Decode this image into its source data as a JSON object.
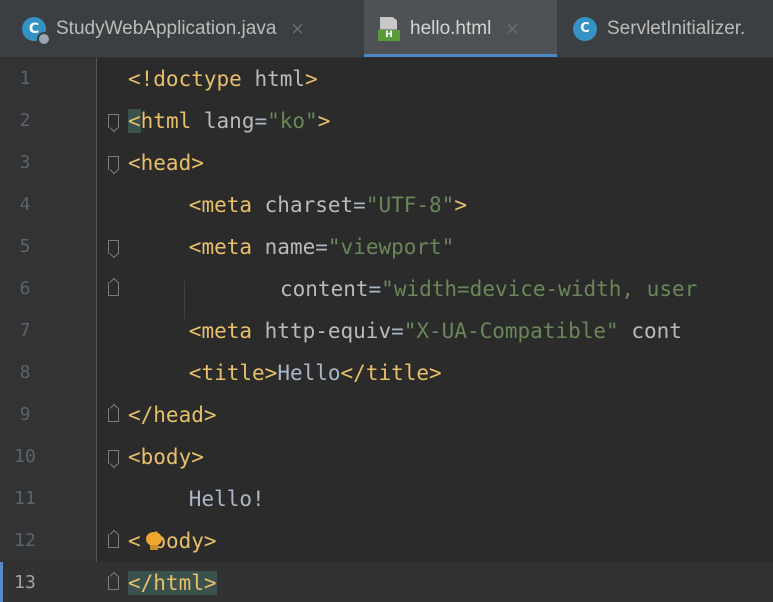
{
  "tabs": [
    {
      "label": "StudyWebApplication.java",
      "icon": "java-class-icon",
      "close": "×",
      "active": false
    },
    {
      "label": "hello.html",
      "icon": "html-file-icon",
      "icon_text": "H",
      "close": "×",
      "active": true
    },
    {
      "label": "ServletInitializer.",
      "icon": "class-icon",
      "icon_text": "C",
      "active": false
    }
  ],
  "editor": {
    "current_line": 13,
    "lines": [
      {
        "number": "1",
        "indent": "",
        "parts": [
          {
            "t": "tag",
            "v": "<!doctype "
          },
          {
            "t": "attr",
            "v": "html"
          },
          {
            "t": "tag",
            "v": ">"
          }
        ]
      },
      {
        "number": "2",
        "indent": "",
        "fold": "open",
        "parts": [
          {
            "t": "tag hl",
            "v": "<"
          },
          {
            "t": "tag",
            "v": "html"
          },
          {
            "t": "txt",
            "v": " "
          },
          {
            "t": "attr",
            "v": "lang"
          },
          {
            "t": "txt",
            "v": "="
          },
          {
            "t": "str",
            "v": "\"ko\""
          },
          {
            "t": "tag",
            "v": ">"
          }
        ]
      },
      {
        "number": "3",
        "indent": "",
        "fold": "open",
        "parts": [
          {
            "t": "tag",
            "v": "<head>"
          }
        ]
      },
      {
        "number": "4",
        "indent": "    ",
        "parts": [
          {
            "t": "tag",
            "v": "<meta "
          },
          {
            "t": "attr",
            "v": "charset"
          },
          {
            "t": "txt",
            "v": "="
          },
          {
            "t": "str",
            "v": "\"UTF-8\""
          },
          {
            "t": "tag",
            "v": ">"
          }
        ]
      },
      {
        "number": "5",
        "indent": "    ",
        "fold": "open",
        "parts": [
          {
            "t": "tag",
            "v": "<meta "
          },
          {
            "t": "attr",
            "v": "name"
          },
          {
            "t": "txt",
            "v": "="
          },
          {
            "t": "str",
            "v": "\"viewport\""
          }
        ]
      },
      {
        "number": "6",
        "indent": "          ",
        "fold": "close",
        "parts": [
          {
            "t": "attr",
            "v": "content"
          },
          {
            "t": "txt",
            "v": "="
          },
          {
            "t": "str",
            "v": "\"width=device-width, user"
          }
        ]
      },
      {
        "number": "7",
        "indent": "    ",
        "parts": [
          {
            "t": "tag",
            "v": "<meta "
          },
          {
            "t": "attr",
            "v": "http-equiv"
          },
          {
            "t": "txt",
            "v": "="
          },
          {
            "t": "str",
            "v": "\"X-UA-Compatible\""
          },
          {
            "t": "txt",
            "v": " "
          },
          {
            "t": "attr",
            "v": "cont"
          }
        ]
      },
      {
        "number": "8",
        "indent": "    ",
        "parts": [
          {
            "t": "tag",
            "v": "<title>"
          },
          {
            "t": "txt",
            "v": "Hello"
          },
          {
            "t": "tag",
            "v": "</title>"
          }
        ]
      },
      {
        "number": "9",
        "indent": "",
        "fold": "close",
        "parts": [
          {
            "t": "tag",
            "v": "</head>"
          }
        ]
      },
      {
        "number": "10",
        "indent": "",
        "fold": "open",
        "parts": [
          {
            "t": "tag",
            "v": "<body>"
          }
        ]
      },
      {
        "number": "11",
        "indent": "    ",
        "parts": [
          {
            "t": "txt",
            "v": "Hello!"
          }
        ]
      },
      {
        "number": "12",
        "indent": "",
        "fold": "close",
        "bulb": true,
        "parts": [
          {
            "t": "tag",
            "v": "<"
          },
          {
            "t": "tag",
            "v": " "
          },
          {
            "t": "tag",
            "v": "body>"
          }
        ]
      },
      {
        "number": "13",
        "indent": "",
        "fold": "close",
        "parts": [
          {
            "t": "tag hl",
            "v": "</html>"
          }
        ]
      }
    ]
  },
  "colors": {
    "tag": "#e8bf6a",
    "attribute": "#bababa",
    "string": "#6a8759",
    "text": "#a9b7c6",
    "accent": "#4a88c7"
  }
}
